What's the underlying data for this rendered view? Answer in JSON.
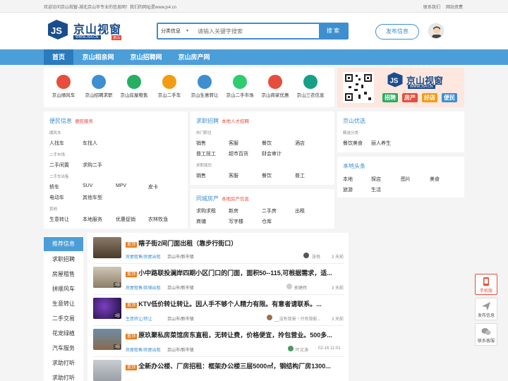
{
  "topbar": {
    "welcome": "欢迎访问京山视窗-湖北京山市专业的信息网！我们的网址是www.js4.cn",
    "links": [
      "联系我们",
      "网站资费"
    ]
  },
  "header": {
    "logo_text": "京山视窗",
    "logo_url": "WWW.JS4.CN",
    "logo_badge": "京山",
    "search_category": "分类信息",
    "search_placeholder": "请输入关键字搜索",
    "search_button": "搜 索",
    "publish_button": "发布信息"
  },
  "nav": [
    "首页",
    "京山相亲网",
    "京山招聘网",
    "京山房产网"
  ],
  "quick_icons": [
    {
      "label": "京山顺风车",
      "color": "#e74c3c"
    },
    {
      "label": "京山招聘求职",
      "color": "#3d8fcf"
    },
    {
      "label": "京山房屋租售",
      "color": "#27ae60"
    },
    {
      "label": "京山二手车",
      "color": "#f39c12"
    },
    {
      "label": "京山生意转让",
      "color": "#3d8fcf"
    },
    {
      "label": "京山二手市场",
      "color": "#2ecc71"
    },
    {
      "label": "京山商家优惠",
      "color": "#e74c3c"
    },
    {
      "label": "京山三农信息",
      "color": "#16a085"
    }
  ],
  "banner": {
    "name": "京山视窗",
    "url": "WWW.JS4.CN",
    "tags": [
      "招聘",
      "房产",
      "好店",
      "便民"
    ]
  },
  "convenience": {
    "title": "便民信息",
    "sub": "便民服务",
    "groups": [
      {
        "name": "顺风车",
        "links": [
          "人找车",
          "车找人"
        ]
      },
      {
        "name": "二手市场",
        "links": [
          "二手闲置",
          "求购二手"
        ]
      },
      {
        "name": "二手车出售",
        "links": [
          "轿车",
          "SUV",
          "MPV",
          "皮卡",
          "电动车",
          "其他车型"
        ]
      },
      {
        "name": "其他",
        "links": [
          "生意转让",
          "本地服务",
          "优惠促销",
          "农林牧渔"
        ]
      }
    ]
  },
  "jobs": {
    "title": "求职招聘",
    "sub": "本地人才招聘",
    "groups": [
      {
        "name": "热门职位",
        "links": [
          "销售",
          "客服",
          "餐饮",
          "酒店",
          "普工技工",
          "超市百货",
          "财会审计"
        ]
      },
      {
        "name": "求职简历",
        "links": [
          "销售",
          "客服",
          "餐饮",
          "普工"
        ]
      }
    ]
  },
  "realestate": {
    "title": "同城房产",
    "sub": "本地房产信息",
    "links": [
      "求购求租",
      "新房",
      "二手房",
      "出租",
      "商铺",
      "写字楼",
      "仓库"
    ]
  },
  "jingshan_select": {
    "title": "京山优选",
    "group": "精选分类",
    "links": [
      "餐饮美食",
      "丽人养生"
    ]
  },
  "local_news": {
    "title": "本地头条",
    "links": [
      "本地",
      "探店",
      "图片",
      "美食",
      "旅游",
      "生活"
    ]
  },
  "sidenav": [
    "推荐信息",
    "求职招聘",
    "房屋租售",
    "拼顺风车",
    "生意转让",
    "二手交易",
    "汽车服务",
    "花宠绿植",
    "求助打听"
  ],
  "listings": [
    {
      "tag": "置顶",
      "title": "瞎子街2间门面出租（靠步行街口）",
      "cats": "房屋租售/房屋出租",
      "loc": "京山市/新市镇",
      "user": "张悦",
      "time": "3 天前",
      "count": ""
    },
    {
      "tag": "置顶",
      "title": "小中路联投澜岸四期小区门口的门面，面积50--115,可根据需求，适...",
      "cats": "房屋租售/商铺出租",
      "loc": "京山市/新市镇",
      "user": "郭建辉",
      "time": "3 天前",
      "count": "3图"
    },
    {
      "tag": "置顶",
      "title": "KTV低价转让转让。因人手不够个人精力有限。有意者请联系。...",
      "cats": "生意转让/转让",
      "loc": "京山市/新市镇",
      "user": "__没有背景丶只有背影...",
      "time": "3 天前",
      "count": "3图"
    },
    {
      "tag": "置顶",
      "title": "原玖聚私房菜馆房东直租，无转让费，价格便宜，拎包营业。500多...",
      "cats": "房屋租售/房屋出租",
      "loc": "京山市/新市镇",
      "user": "叶文涛",
      "time": "02-16 11:01",
      "count": "3图"
    },
    {
      "tag": "置顶",
      "title": "全新办公楼、厂房招租：框架办公楼三层5000㎡，钢结构厂房1300...",
      "cats": "",
      "loc": "",
      "user": "",
      "time": "",
      "count": ""
    }
  ],
  "float": [
    "手机版",
    "发布信息",
    "联系客服"
  ]
}
